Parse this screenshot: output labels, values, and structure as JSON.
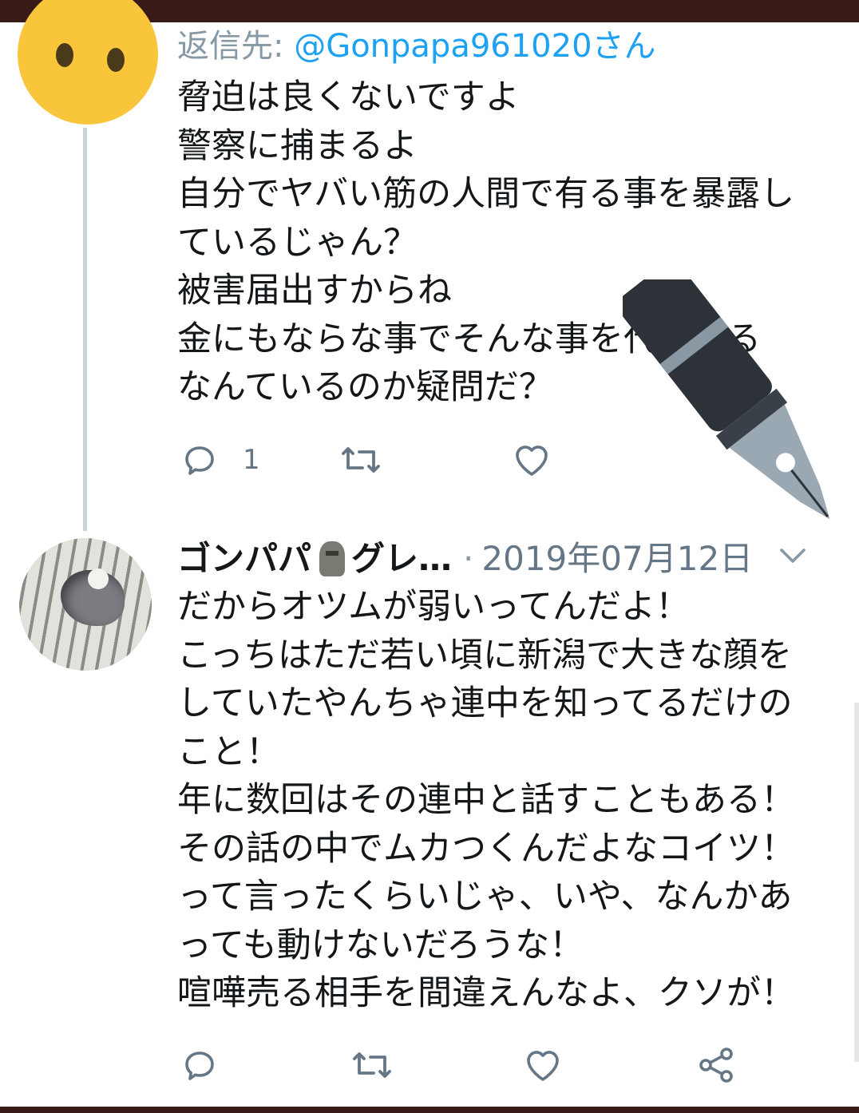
{
  "tweet1": {
    "reply_prefix": "返信先:",
    "reply_handle": "@Gonpapa961020さん",
    "lines": [
      "脅迫は良くないですよ",
      "警察に捕まるよ",
      "自分でヤバい筋の人間で有る事を暴露し",
      "ているじゃん？",
      "被害届出すからね",
      "金にもならな事でそんな事を代行する",
      "なんているのか疑問だ？"
    ],
    "reply_count": "1"
  },
  "tweet2": {
    "name": "ゴンパパ",
    "name_suffix": "グレ…",
    "separator": "·",
    "date": "2019年07月12日",
    "lines": [
      "だからオツムが弱いってんだよ！",
      "こっちはただ若い頃に新潟で大きな顔を",
      "していたやんちゃ連中を知ってるだけの",
      "こと！",
      "年に数回はその連中と話すこともある！",
      "その話の中でムカつくんだよなコイツ！",
      "って言ったくらいじゃ、いや、なんかあ",
      "っても動けないだろうな！",
      "喧嘩売る相手を間違えんなよ、クソが！"
    ]
  },
  "icons": {
    "reply": "reply-icon",
    "retweet": "retweet-icon",
    "like": "heart-icon",
    "share": "share-icon",
    "chevron": "chevron-down-icon",
    "pen": "fountain-pen-icon"
  },
  "colors": {
    "link": "#1da1f2",
    "secondary_text": "#8899a6",
    "text": "#14171a",
    "thread_line": "#c9d3dc",
    "frame": "#3a1a16"
  }
}
